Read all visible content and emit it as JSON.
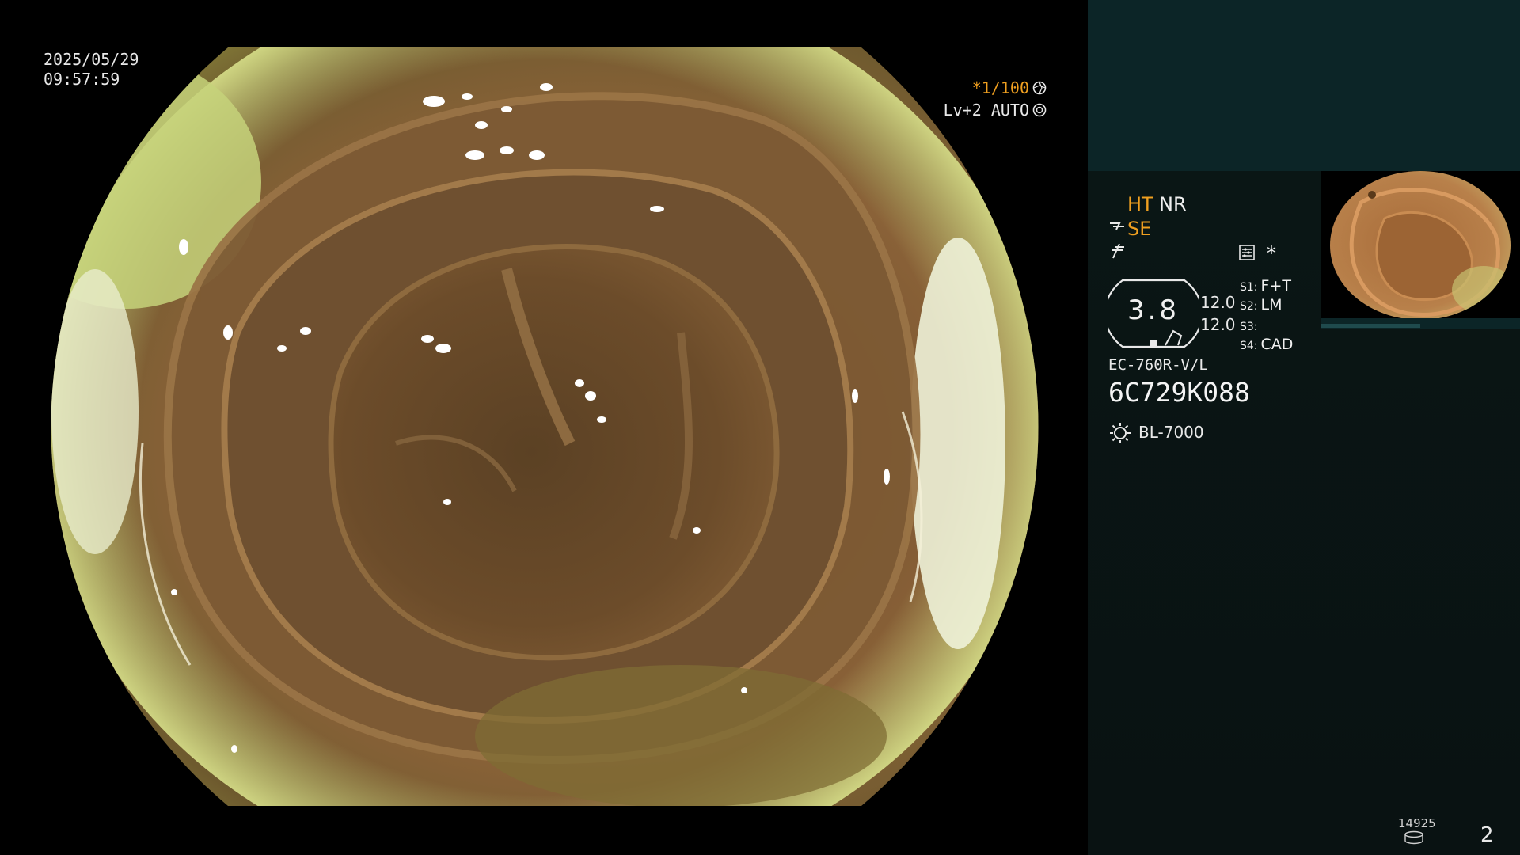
{
  "overlay": {
    "date": "2025/05/29",
    "time": "09:57:59",
    "shutter": "*1/100",
    "exposure": "Lv+2 AUTO"
  },
  "panel": {
    "ht": "HT",
    "nr": "NR",
    "se": "SE",
    "star": "*",
    "zoom_value": "3.8",
    "value_a": "12.0",
    "value_b": "12.0",
    "switches": [
      {
        "key": "S1:",
        "value": "F+T"
      },
      {
        "key": "S2:",
        "value": "LM"
      },
      {
        "key": "S3:",
        "value": ""
      },
      {
        "key": "S4:",
        "value": "CAD"
      }
    ],
    "scope_model": "EC-760R-V/L",
    "scope_serial": "6C729K088",
    "light_source": "BL-7000",
    "image_count": "14925",
    "page_number": "2"
  },
  "colors": {
    "accent_orange": "#f0a020",
    "panel_top": "#0c2527",
    "panel_bg": "#091212",
    "text": "#e8e8e8"
  },
  "icons": [
    "shutter-ring-icon",
    "exposure-ring-icon",
    "se-scope-icon",
    "freeze-icon",
    "settings-icon",
    "light-source-icon",
    "disk-icon"
  ]
}
